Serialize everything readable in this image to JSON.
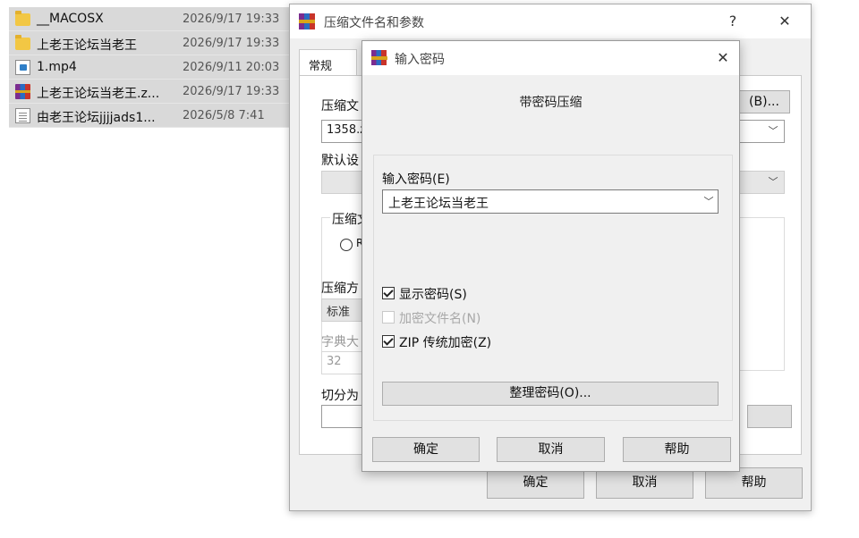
{
  "file_list": [
    {
      "name": "__MACOSX",
      "date": "2026/9/17 19:33",
      "icon": "folder-icon"
    },
    {
      "name": "上老王论坛当老王",
      "date": "2026/9/17 19:33",
      "icon": "folder-icon"
    },
    {
      "name": "1.mp4",
      "date": "2026/9/11 20:03",
      "icon": "video-file-icon"
    },
    {
      "name": "上老王论坛当老王.z...",
      "date": "2026/9/17 19:33",
      "icon": "archive-icon"
    },
    {
      "name": "由老王论坛jjjjads1...",
      "date": "2026/5/8 7:41",
      "icon": "text-file-icon"
    }
  ],
  "main_dialog": {
    "title": "压缩文件名和参数",
    "help_glyph": "?",
    "close_glyph": "✕",
    "tab_general": "常规",
    "label_archive_name": "压缩文",
    "archive_name_value": "1358.z",
    "browse_button": "(B)...",
    "label_default_profile": "默认设",
    "label_format_group": "压缩文",
    "radio_partial": "R",
    "label_method": "压缩方",
    "method_value": "标准",
    "label_dict": "字典大",
    "dict_value": "32",
    "label_split": "切分为",
    "ok": "确定",
    "cancel": "取消",
    "help": "帮助"
  },
  "password_dialog": {
    "title": "输入密码",
    "close_glyph": "✕",
    "heading": "带密码压缩",
    "password_label": "输入密码(E)",
    "password_value": "上老王论坛当老王",
    "show_password": {
      "label": "显示密码(S)",
      "checked": true
    },
    "encrypt_names": {
      "label": "加密文件名(N)",
      "checked": false,
      "disabled": true
    },
    "zip_legacy": {
      "label": "ZIP 传统加密(Z)",
      "checked": true
    },
    "manage_button": "整理密码(O)...",
    "ok": "确定",
    "cancel": "取消",
    "help": "帮助"
  },
  "colors": {
    "archive_icon": [
      "#7b2c8f",
      "#2a6cc2",
      "#c8342a",
      "#d9a41a"
    ],
    "folder": "#f2c744"
  }
}
